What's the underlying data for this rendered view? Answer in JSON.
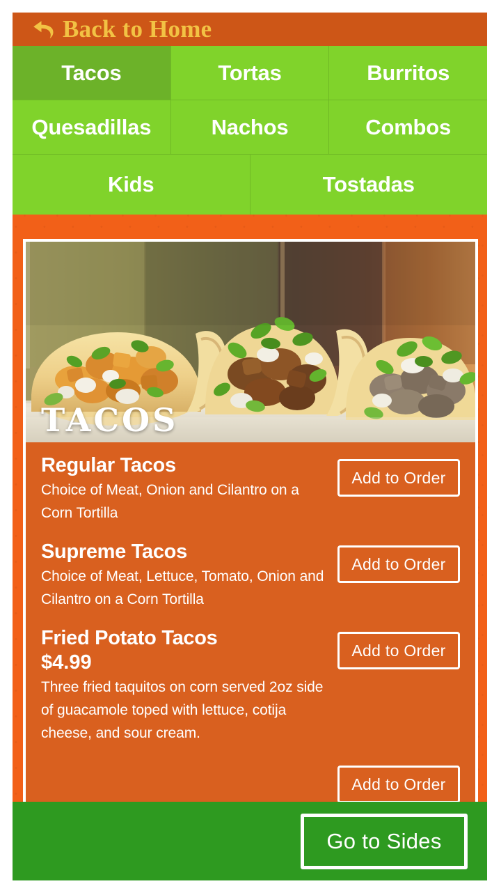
{
  "header": {
    "back_label": "Back to Home",
    "back_icon": "back-arrow-icon",
    "bar_color": "#CD5617",
    "text_color": "#F2C244"
  },
  "categories": {
    "active": "Tacos",
    "active_color": "#6CB229",
    "tab_color": "#80D32B",
    "rows": [
      [
        "Tacos",
        "Tortas",
        "Burritos"
      ],
      [
        "Quesadillas",
        "Nachos",
        "Combos"
      ],
      [
        "Kids",
        "Tostadas"
      ]
    ]
  },
  "hero": {
    "title": "TACOS",
    "alt": "three-tacos-photo"
  },
  "menu": {
    "panel_color": "#D9601F",
    "items": [
      {
        "name": "Regular Tacos",
        "price": "",
        "desc": "Choice of Meat, Onion and Cilantro on a Corn Tortilla",
        "button": "Add to Order"
      },
      {
        "name": "Supreme Tacos",
        "price": "",
        "desc": "Choice of Meat, Lettuce, Tomato, Onion and Cilantro on a Corn Tortilla",
        "button": "Add to Order"
      },
      {
        "name": "Fried Potato Tacos",
        "price": "$4.99",
        "desc": "Three fried taquitos on corn served 2oz side of guacamole toped with lettuce, cotija cheese, and sour cream.",
        "button": "Add to Order"
      },
      {
        "name": "",
        "price": "",
        "desc": "",
        "button": "Add to Order"
      }
    ]
  },
  "footer": {
    "sides_label": "Go to Sides",
    "bar_color": "#2E9A20"
  }
}
